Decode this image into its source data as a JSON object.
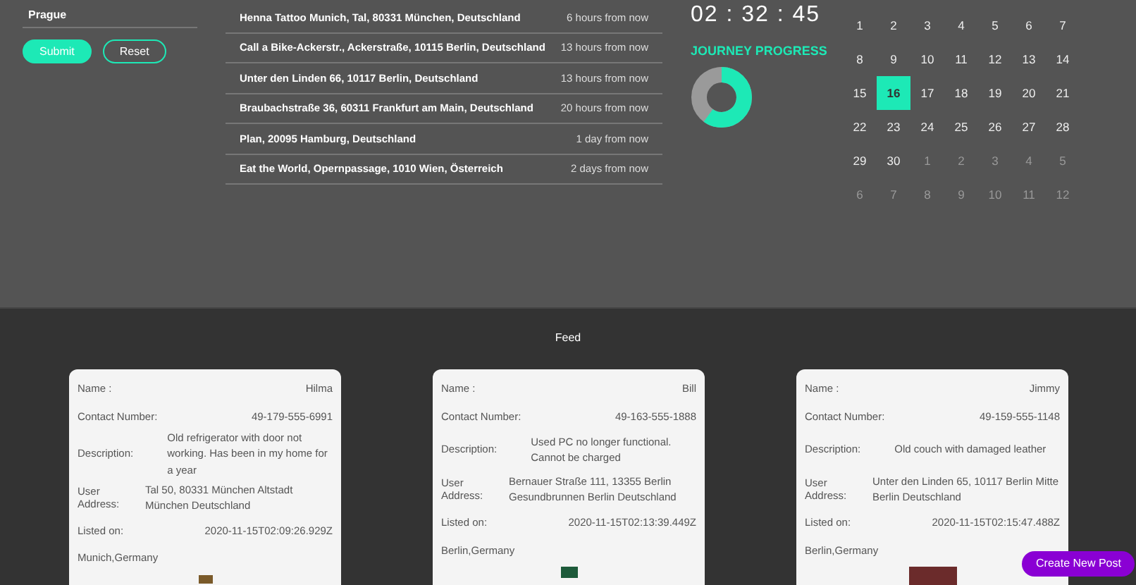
{
  "search_form": {
    "field_value": "Prague",
    "buttons": [
      {
        "label": "Submit",
        "kind": "primary"
      },
      {
        "label": "Reset",
        "kind": "outline"
      }
    ]
  },
  "places": [
    {
      "name": "Henna Tattoo Munich, Tal, 80331 München, Deutschland",
      "time": "6 hours from now"
    },
    {
      "name": "Call a Bike-Ackerstr., Ackerstraße, 10115 Berlin, Deutschland",
      "time": "13 hours from now"
    },
    {
      "name": "Unter den Linden 66, 10117 Berlin, Deutschland",
      "time": "13 hours from now"
    },
    {
      "name": "Braubachstraße 36, 60311 Frankfurt am Main, Deutschland",
      "time": "20 hours from now"
    },
    {
      "name": "Plan, 20095 Hamburg, Deutschland",
      "time": "1 day from now"
    },
    {
      "name": "Eat the World, Opernpassage, 1010 Wien, Österreich",
      "time": "2 days from now"
    }
  ],
  "clock": "02 : 32 : 45",
  "journey_progress": {
    "title": "JOURNEY PROGRESS",
    "level": 0.6
  },
  "calendar": {
    "days": [
      {
        "label": "1",
        "other_month": false,
        "selected": false
      },
      {
        "label": "2",
        "other_month": false,
        "selected": false
      },
      {
        "label": "3",
        "other_month": false,
        "selected": false
      },
      {
        "label": "4",
        "other_month": false,
        "selected": false
      },
      {
        "label": "5",
        "other_month": false,
        "selected": false
      },
      {
        "label": "6",
        "other_month": false,
        "selected": false
      },
      {
        "label": "7",
        "other_month": false,
        "selected": false
      },
      {
        "label": "8",
        "other_month": false,
        "selected": false
      },
      {
        "label": "9",
        "other_month": false,
        "selected": false
      },
      {
        "label": "10",
        "other_month": false,
        "selected": false
      },
      {
        "label": "11",
        "other_month": false,
        "selected": false
      },
      {
        "label": "12",
        "other_month": false,
        "selected": false
      },
      {
        "label": "13",
        "other_month": false,
        "selected": false
      },
      {
        "label": "14",
        "other_month": false,
        "selected": false
      },
      {
        "label": "15",
        "other_month": false,
        "selected": false
      },
      {
        "label": "16",
        "other_month": false,
        "selected": true
      },
      {
        "label": "17",
        "other_month": false,
        "selected": false
      },
      {
        "label": "18",
        "other_month": false,
        "selected": false
      },
      {
        "label": "19",
        "other_month": false,
        "selected": false
      },
      {
        "label": "20",
        "other_month": false,
        "selected": false
      },
      {
        "label": "21",
        "other_month": false,
        "selected": false
      },
      {
        "label": "22",
        "other_month": false,
        "selected": false
      },
      {
        "label": "23",
        "other_month": false,
        "selected": false
      },
      {
        "label": "24",
        "other_month": false,
        "selected": false
      },
      {
        "label": "25",
        "other_month": false,
        "selected": false
      },
      {
        "label": "26",
        "other_month": false,
        "selected": false
      },
      {
        "label": "27",
        "other_month": false,
        "selected": false
      },
      {
        "label": "28",
        "other_month": false,
        "selected": false
      },
      {
        "label": "29",
        "other_month": false,
        "selected": false
      },
      {
        "label": "30",
        "other_month": false,
        "selected": false
      },
      {
        "label": "1",
        "other_month": true,
        "selected": false
      },
      {
        "label": "2",
        "other_month": true,
        "selected": false
      },
      {
        "label": "3",
        "other_month": true,
        "selected": false
      },
      {
        "label": "4",
        "other_month": true,
        "selected": false
      },
      {
        "label": "5",
        "other_month": true,
        "selected": false
      },
      {
        "label": "6",
        "other_month": true,
        "selected": false
      },
      {
        "label": "7",
        "other_month": true,
        "selected": false
      },
      {
        "label": "8",
        "other_month": true,
        "selected": false
      },
      {
        "label": "9",
        "other_month": true,
        "selected": false
      },
      {
        "label": "10",
        "other_month": true,
        "selected": false
      },
      {
        "label": "11",
        "other_month": true,
        "selected": false
      },
      {
        "label": "12",
        "other_month": true,
        "selected": false
      }
    ]
  },
  "feed": {
    "title": "Feed",
    "posts": [
      {
        "name_label": "Name :",
        "name": "Hilma",
        "contact_label": "Contact Number:",
        "contact": "49-179-555-6991",
        "description_label": "Description:",
        "description": "Old refrigerator with door not working. Has been in my home for a year",
        "address_label": "User Address:",
        "address": "Tal 50, 80331 München Altstadt München Deutschland",
        "listed_label": "Listed on:",
        "listed": "2020-11-15T02:09:26.929Z",
        "location": "Munich,Germany"
      },
      {
        "name_label": "Name :",
        "name": "Bill",
        "contact_label": "Contact Number:",
        "contact": "49-163-555-1888",
        "description_label": "Description:",
        "description": "Used PC no longer functional. Cannot be charged",
        "address_label": "User Address:",
        "address": "Bernauer Straße 111, 13355 Berlin Gesundbrunnen Berlin Deutschland",
        "listed_label": "Listed on:",
        "listed": "2020-11-15T02:13:39.449Z",
        "location": "Berlin,Germany"
      },
      {
        "name_label": "Name :",
        "name": "Jimmy",
        "contact_label": "Contact Number:",
        "contact": "49-159-555-1148",
        "description_label": "Description:",
        "description": "Old couch with damaged leather",
        "address_label": "User Address:",
        "address": "Unter den Linden 65, 10117 Berlin Mitte Berlin Deutschland",
        "listed_label": "Listed on:",
        "listed": "2020-11-15T02:15:47.488Z",
        "location": "Berlin,Germany"
      }
    ]
  },
  "create_button": "Create New Post"
}
